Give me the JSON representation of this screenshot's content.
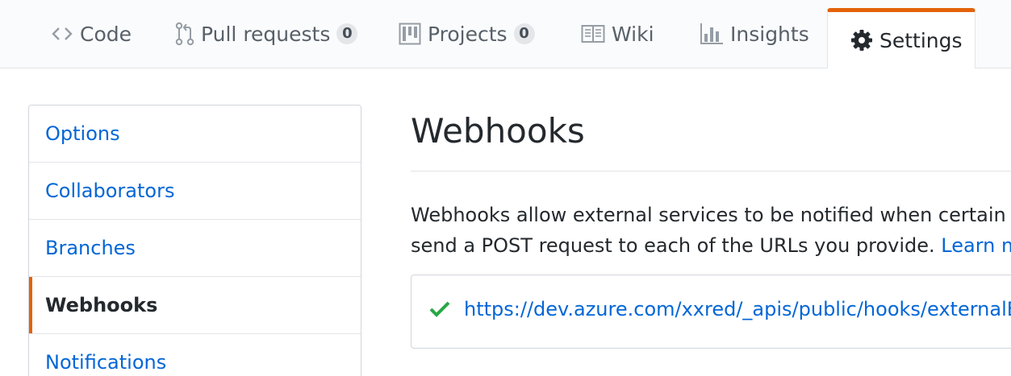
{
  "tabs": {
    "code": {
      "label": "Code",
      "icon": "code-icon"
    },
    "pull_requests": {
      "label": "Pull requests",
      "count": "0",
      "icon": "git-pull-request-icon"
    },
    "projects": {
      "label": "Projects",
      "count": "0",
      "icon": "project-board-icon"
    },
    "wiki": {
      "label": "Wiki",
      "icon": "book-icon"
    },
    "insights": {
      "label": "Insights",
      "icon": "graph-icon"
    },
    "settings": {
      "label": "Settings",
      "icon": "gear-icon",
      "selected": true
    }
  },
  "sidebar": {
    "items": [
      {
        "label": "Options"
      },
      {
        "label": "Collaborators"
      },
      {
        "label": "Branches"
      },
      {
        "label": "Webhooks",
        "selected": true
      },
      {
        "label": "Notifications"
      }
    ]
  },
  "main": {
    "title": "Webhooks",
    "description_line1": "Webhooks allow external services to be notified when certain eve",
    "description_line2_prefix": "send a POST request to each of the URLs you provide. ",
    "description_link": "Learn mor",
    "webhook": {
      "status_icon": "check-icon",
      "url": "https://dev.azure.com/xxred/_apis/public/hooks/externalEvents"
    }
  },
  "colors": {
    "accent": "#e36209",
    "link": "#0366d6",
    "success": "#28a745"
  }
}
